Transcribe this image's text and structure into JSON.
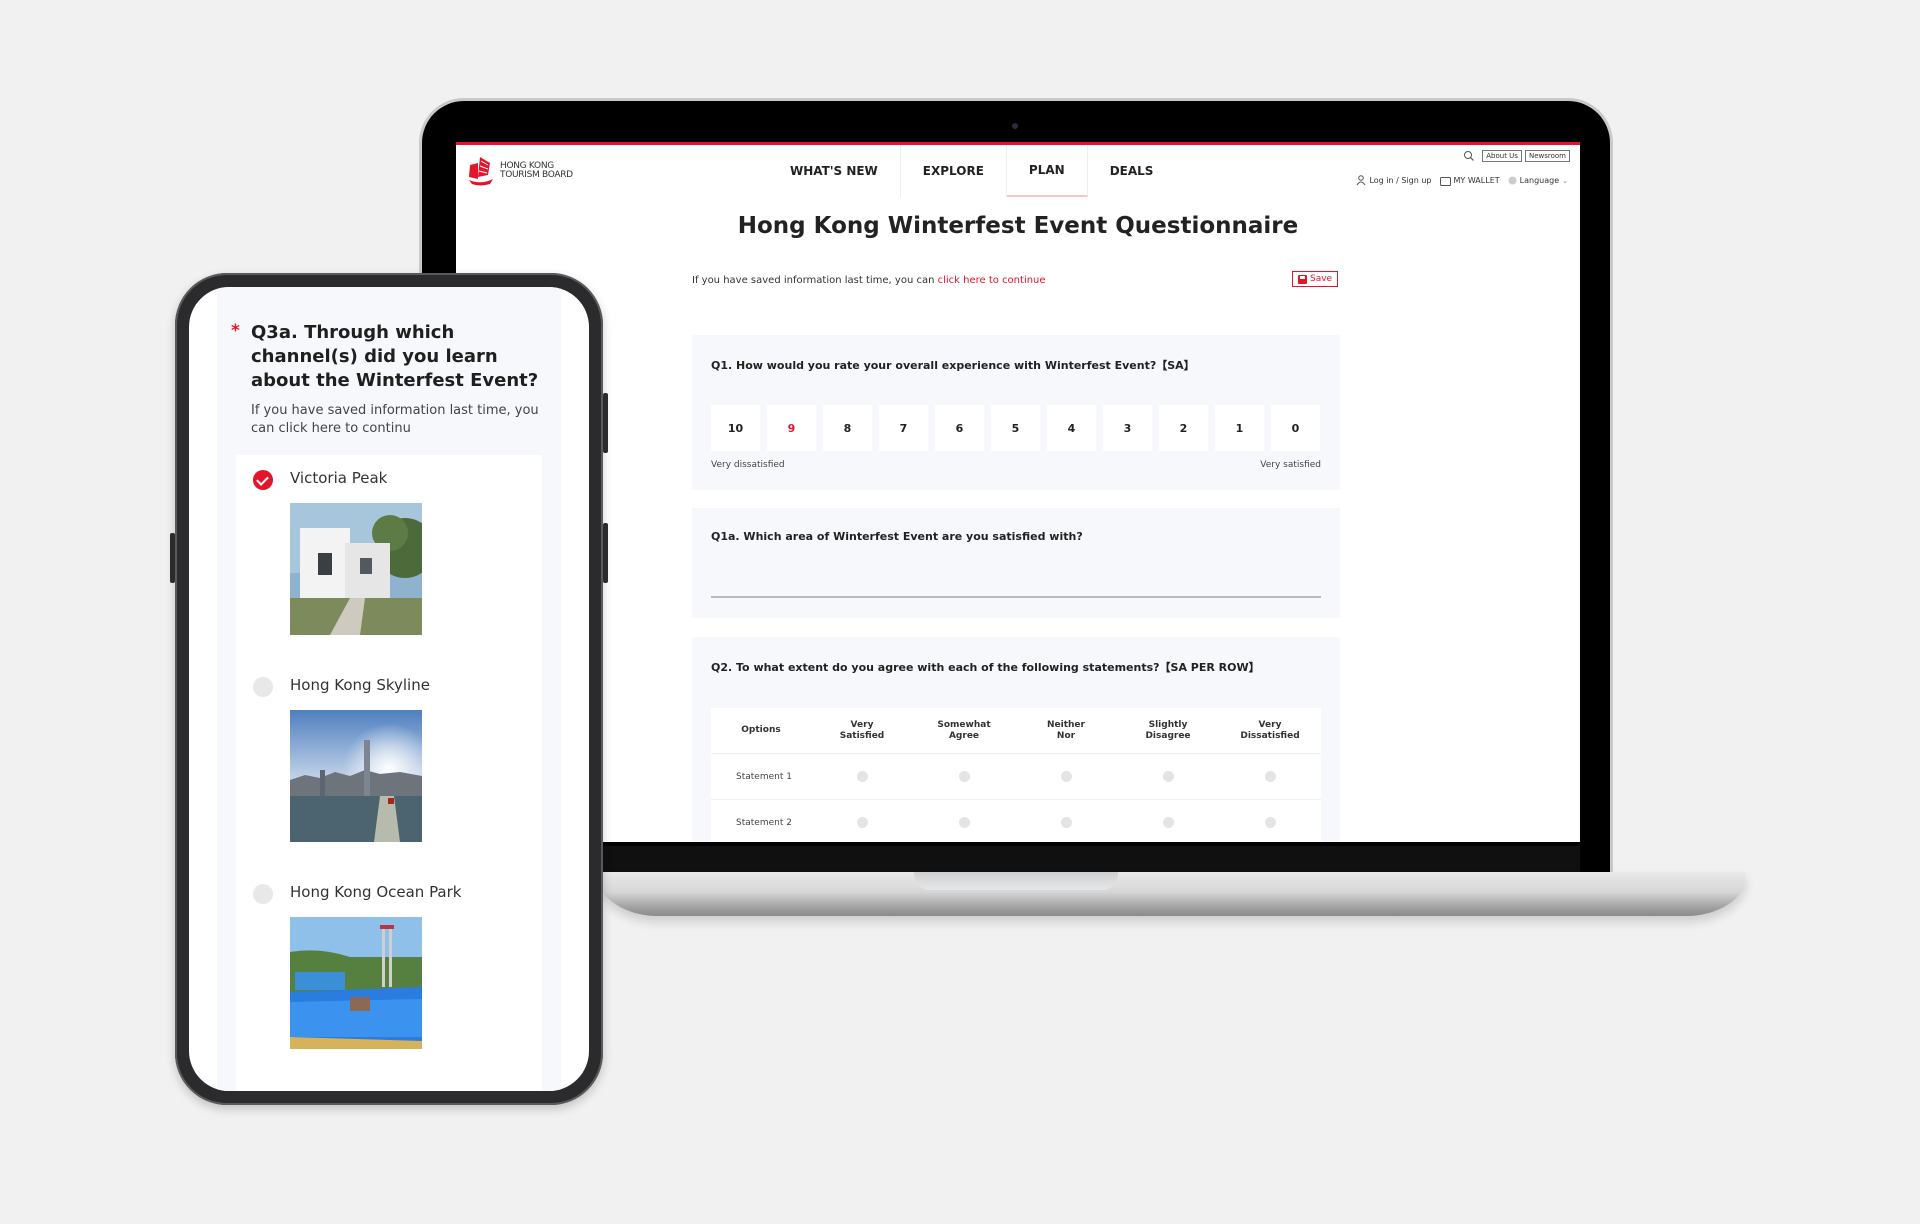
{
  "desktop": {
    "logo": {
      "line1": "HONG KONG",
      "line2": "TOURISM BOARD"
    },
    "nav": [
      {
        "label": "WHAT'S NEW",
        "active": false
      },
      {
        "label": "EXPLORE",
        "active": false
      },
      {
        "label": "PLAN",
        "active": true
      },
      {
        "label": "DEALS",
        "active": false
      }
    ],
    "utility": {
      "about_us": "About Us",
      "newsroom": "Newsroom",
      "login": "Log in / Sign up",
      "wallet": "MY WALLET",
      "language": "Language"
    },
    "page_title": "Hong Kong Winterfest Event Questionnaire",
    "save_info_text": "If you have saved information last time, you can ",
    "save_info_link": "click here to continue",
    "save_button": "Save",
    "q1": {
      "title": "Q1.  How would you rate your overall experience with Winterfest Event?【SA】",
      "scale": [
        "10",
        "9",
        "8",
        "7",
        "6",
        "5",
        "4",
        "3",
        "2",
        "1",
        "0"
      ],
      "selected": "9",
      "left_label": "Very dissatisfied",
      "right_label": "Very satisfied"
    },
    "q1a": {
      "title": "Q1a. Which area of Winterfest Event are you satisfied with?",
      "value": ""
    },
    "q2": {
      "title": "Q2. To what extent do you agree with each of the following statements?【SA PER ROW】",
      "columns": [
        "Options",
        "Very\nSatisfied",
        "Somewhat\nAgree",
        "Neither\nNor",
        "Slightly\nDisagree",
        "Very\nDissatisfied"
      ],
      "rows": [
        "Statement 1",
        "Statement 2"
      ]
    }
  },
  "mobile": {
    "required_mark": "*",
    "question": "Q3a. Through which channel(s) did you learn about the Winterfest Event?",
    "subtext": "If you have saved information last time, you can click here to continu",
    "options": [
      {
        "label": "Victoria Peak",
        "checked": true,
        "image": "white-modern-villa-photo"
      },
      {
        "label": "Hong Kong Skyline",
        "checked": false,
        "image": "harbour-skyline-photo"
      },
      {
        "label": "Hong Kong Ocean Park",
        "checked": false,
        "image": "ocean-park-pool-photo"
      }
    ]
  },
  "colors": {
    "brand_red": "#e3152b",
    "card_bg": "#f6f8fb"
  }
}
